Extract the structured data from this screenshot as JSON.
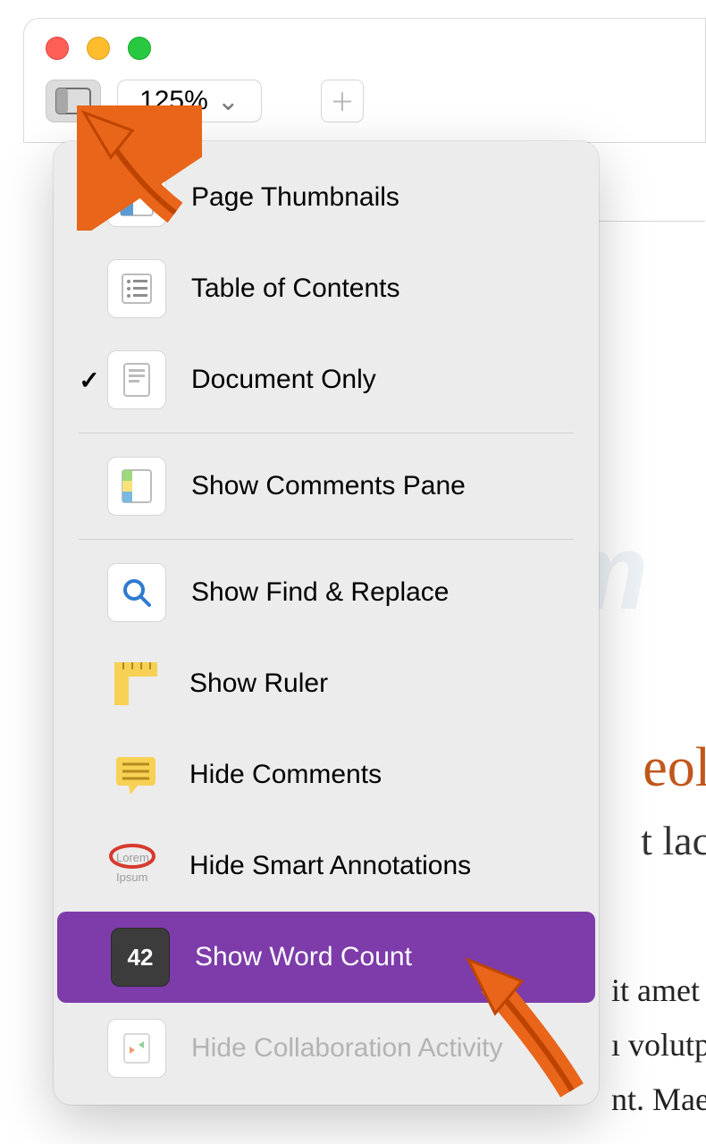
{
  "toolbar": {
    "zoom": "125%"
  },
  "menu": {
    "items": [
      {
        "key": "page-thumbnails",
        "label": "Page Thumbnails",
        "checked": false
      },
      {
        "key": "table-of-contents",
        "label": "Table of Contents",
        "checked": false
      },
      {
        "key": "document-only",
        "label": "Document Only",
        "checked": true
      }
    ],
    "items2": [
      {
        "key": "show-comments-pane",
        "label": "Show Comments Pane"
      }
    ],
    "items3": [
      {
        "key": "show-find-replace",
        "label": "Show Find & Replace"
      },
      {
        "key": "show-ruler",
        "label": "Show Ruler"
      },
      {
        "key": "hide-comments",
        "label": "Hide Comments"
      },
      {
        "key": "hide-smart-annotations",
        "label": "Hide Smart Annotations"
      },
      {
        "key": "show-word-count",
        "label": "Show Word Count",
        "selected": true,
        "badge": "42"
      },
      {
        "key": "hide-collaboration-activity",
        "label": "Hide Collaboration Activity",
        "disabled": true
      }
    ]
  },
  "document": {
    "title_fragment": "eol",
    "subtitle_fragment": "t lac",
    "body_lines": [
      "it amet",
      "ı volutp",
      "nt. Mae"
    ]
  },
  "watermark": "PCrisk.com"
}
